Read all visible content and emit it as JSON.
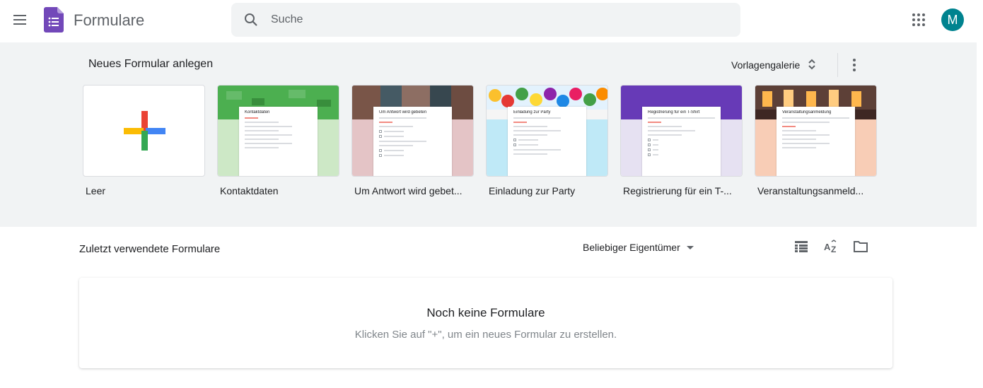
{
  "header": {
    "menu_icon": "hamburger-menu-icon",
    "logo_icon": "forms-logo-icon",
    "app_title": "Formulare",
    "search": {
      "placeholder": "Suche",
      "value": ""
    },
    "apps_icon": "grid-apps-icon",
    "avatar_letter": "M"
  },
  "gallery": {
    "title": "Neues Formular anlegen",
    "toggle_label": "Vorlagengalerie",
    "templates": [
      {
        "label": "Leer"
      },
      {
        "label": "Kontaktdaten",
        "sheet_title": "Kontaktdaten"
      },
      {
        "label": "Um Antwort wird gebet...",
        "sheet_title": "Um Antwort wird gebeten"
      },
      {
        "label": "Einladung zur Party",
        "sheet_title": "Einladung zur Party"
      },
      {
        "label": "Registrierung für ein T-...",
        "sheet_title": "Registrierung für ein T-Shirt"
      },
      {
        "label": "Veranstaltungsanmeld...",
        "sheet_title": "Veranstaltungsanmeldung"
      }
    ]
  },
  "recent": {
    "title": "Zuletzt verwendete Formulare",
    "owner_filter": "Beliebiger Eigentümer"
  },
  "empty": {
    "title": "Noch keine Formulare",
    "subtitle": "Klicken Sie auf \"+\", um ein neues Formular zu erstellen."
  },
  "colors": {
    "forms_purple": "#7248b9",
    "avatar_teal": "#00838f",
    "gallery_bg": "#f1f3f4"
  }
}
